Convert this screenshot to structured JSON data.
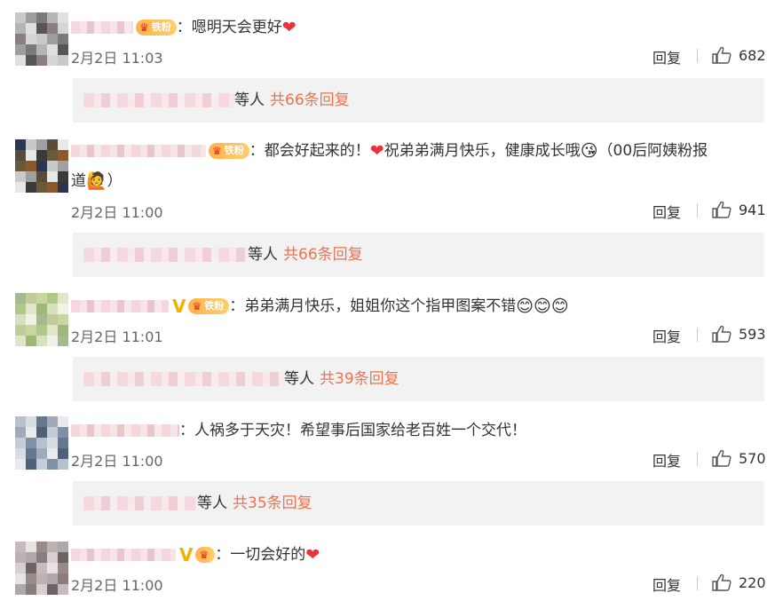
{
  "ui": {
    "reply_label": "回复",
    "thumb_icon": "thumbs-up-icon",
    "fan_badge_text": "铁粉",
    "replies_suffix": "等人"
  },
  "comments": [
    {
      "text": "：嗯明天会更好",
      "time": "2月2日 11:03",
      "likes": "682",
      "replies_count": "共66条回复"
    },
    {
      "text_a": "：都会好起来的！",
      "text_b": "祝弟弟满月快乐，健康成长哦",
      "text_c": "（00后阿姨粉报",
      "text_d": "道",
      "text_e": "）",
      "time": "2月2日 11:00",
      "likes": "941",
      "replies_count": "共66条回复"
    },
    {
      "text": "：弟弟满月快乐，姐姐你这个指甲图案不错",
      "time": "2月2日 11:01",
      "likes": "593",
      "replies_count": "共39条回复"
    },
    {
      "text": "：人祸多于天灾！希望事后国家给老百姓一个交代！",
      "time": "2月2日 11:00",
      "likes": "570",
      "replies_count": "共35条回复"
    },
    {
      "text": "：一切会好的",
      "time": "2月2日 11:00",
      "likes": "220"
    }
  ],
  "colors": {
    "accent_orange": "#eb7350",
    "heart_red": "#e8333a",
    "v_badge_gold": "#f4b000"
  }
}
